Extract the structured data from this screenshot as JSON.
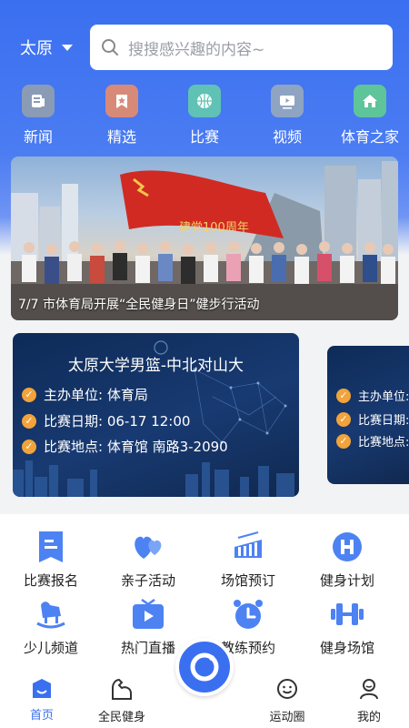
{
  "header": {
    "city": "太原",
    "search_placeholder": "搜搜感兴趣的内容~"
  },
  "quick_nav": [
    {
      "label": "新闻",
      "icon": "news-icon",
      "color": "#8a9bb6"
    },
    {
      "label": "精选",
      "icon": "featured-star-icon",
      "color": "#d78a78"
    },
    {
      "label": "比赛",
      "icon": "basketball-icon",
      "color": "#5fc2b5"
    },
    {
      "label": "视频",
      "icon": "video-icon",
      "color": "#8fa4c2"
    },
    {
      "label": "体育之家",
      "icon": "home-icon",
      "color": "#5ec49a"
    }
  ],
  "banner": {
    "caption": "7/7 市体育局开展“全民健身日”健步行活动",
    "flag_text": "建党100周年"
  },
  "cards": [
    {
      "title": "太原大学男篮-中北对山大",
      "organizer": "主办单位: 体育局",
      "date": "比赛日期: 06-17 12:00",
      "venue": "比赛地点: 体育馆 南路3-2090"
    },
    {
      "organizer": "主办单位:",
      "date": "比赛日期:",
      "venue": "比赛地点:"
    }
  ],
  "services": [
    {
      "label": "比赛报名",
      "icon": "signup-form-icon"
    },
    {
      "label": "亲子活动",
      "icon": "hearts-icon"
    },
    {
      "label": "场馆预订",
      "icon": "stadium-icon"
    },
    {
      "label": "健身计划",
      "icon": "plan-h-icon"
    },
    {
      "label": "少儿频道",
      "icon": "rocking-horse-icon"
    },
    {
      "label": "热门直播",
      "icon": "tv-live-icon"
    },
    {
      "label": "教练预约",
      "icon": "alarm-clock-icon"
    },
    {
      "label": "健身场馆",
      "icon": "dumbbell-icon"
    }
  ],
  "tabs": [
    {
      "label": "首页",
      "icon": "home-tab-icon",
      "active": true
    },
    {
      "label": "全民健身",
      "icon": "arm-muscle-icon",
      "active": false
    },
    {
      "label": "运动圈",
      "icon": "smile-chat-icon",
      "active": false
    },
    {
      "label": "我的",
      "icon": "profile-icon",
      "active": false
    }
  ],
  "colors": {
    "primary": "#3a6ff0",
    "accent_orange": "#f2a33a",
    "service_icon": "#4d82f3"
  }
}
